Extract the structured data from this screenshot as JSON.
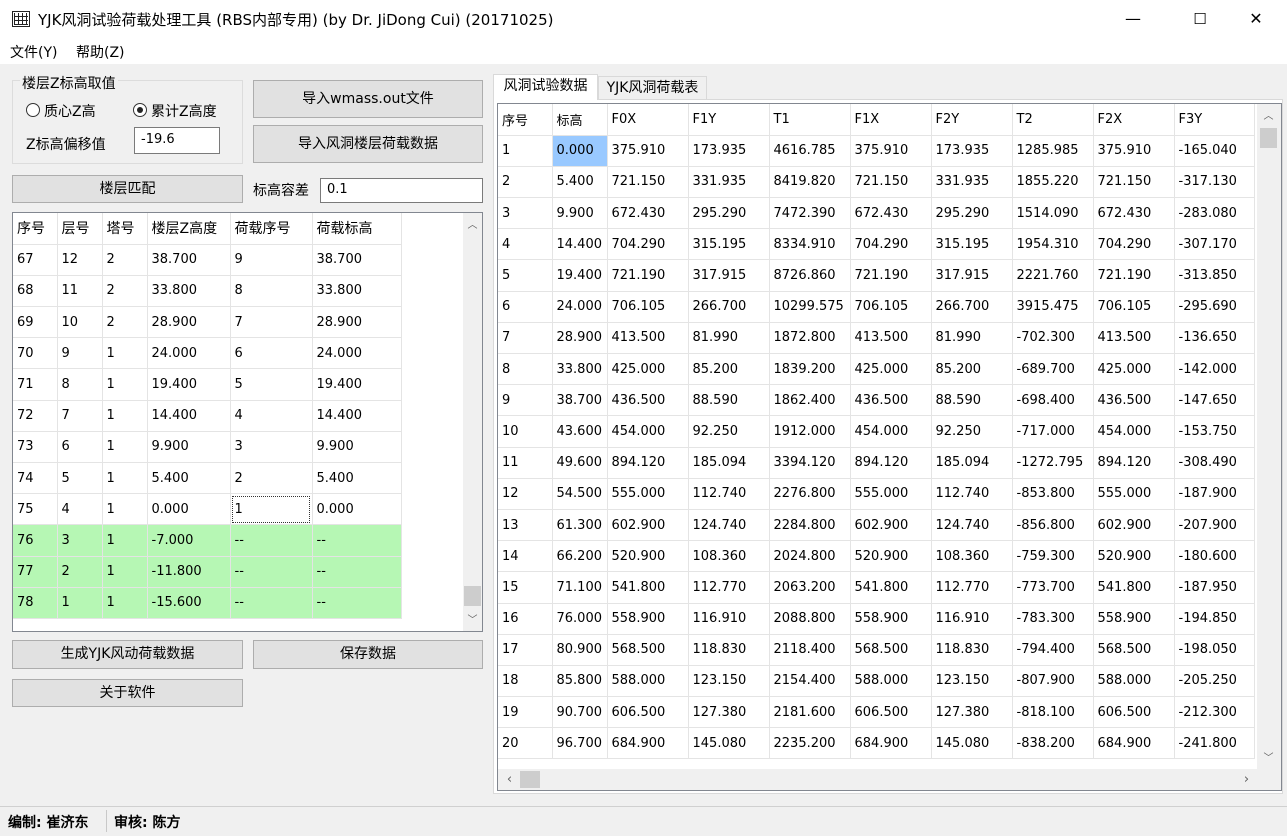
{
  "window": {
    "title": "YJK风洞试验荷载处理工具 (RBS内部专用) (by Dr. JiDong Cui) (20171025)",
    "minimize": "—",
    "maximize": "☐",
    "close": "✕"
  },
  "menu": {
    "file": "文件(Y)",
    "help": "帮助(Z)"
  },
  "zgroup": {
    "legend": "楼层Z标高取值",
    "radio_center": "质心Z高",
    "radio_cumulative": "累计Z高度",
    "selected": "radio_cumulative",
    "offset_label": "Z标高偏移值",
    "offset_value": "-19.6"
  },
  "buttons": {
    "import_wmass": "导入wmass.out文件",
    "import_windtunnel": "导入风洞楼层荷载数据",
    "floor_match": "楼层匹配",
    "generate": "生成YJK风动荷载数据",
    "save": "保存数据",
    "about": "关于软件"
  },
  "tolerance": {
    "label": "标高容差",
    "value": "0.1"
  },
  "left_grid": {
    "headers": [
      "序号",
      "层号",
      "塔号",
      "楼层Z高度",
      "荷载序号",
      "荷载标高"
    ],
    "rows": [
      [
        "67",
        "12",
        "2",
        "38.700",
        "9",
        "38.700"
      ],
      [
        "68",
        "11",
        "2",
        "33.800",
        "8",
        "33.800"
      ],
      [
        "69",
        "10",
        "2",
        "28.900",
        "7",
        "28.900"
      ],
      [
        "70",
        "9",
        "1",
        "24.000",
        "6",
        "24.000"
      ],
      [
        "71",
        "8",
        "1",
        "19.400",
        "5",
        "19.400"
      ],
      [
        "72",
        "7",
        "1",
        "14.400",
        "4",
        "14.400"
      ],
      [
        "73",
        "6",
        "1",
        "9.900",
        "3",
        "9.900"
      ],
      [
        "74",
        "5",
        "1",
        "5.400",
        "2",
        "5.400"
      ],
      [
        "75",
        "4",
        "1",
        "0.000",
        "1",
        "0.000"
      ],
      [
        "76",
        "3",
        "1",
        "-7.000",
        "--",
        "--"
      ],
      [
        "77",
        "2",
        "1",
        "-11.800",
        "--",
        "--"
      ],
      [
        "78",
        "1",
        "1",
        "-15.600",
        "--",
        "--"
      ]
    ],
    "highlight_rows": [
      9,
      10,
      11
    ],
    "highlight_color": "#b6f7b4"
  },
  "tabs": [
    "风洞试验数据",
    "YJK风洞荷载表"
  ],
  "right_grid": {
    "headers": [
      "序号",
      "标高",
      "F0X",
      "F1Y",
      "T1",
      "F1X",
      "F2Y",
      "T2",
      "F2X",
      "F3Y"
    ],
    "rows": [
      [
        "1",
        "0.000",
        "375.910",
        "173.935",
        "4616.785",
        "375.910",
        "173.935",
        "1285.985",
        "375.910",
        "-165.040"
      ],
      [
        "2",
        "5.400",
        "721.150",
        "331.935",
        "8419.820",
        "721.150",
        "331.935",
        "1855.220",
        "721.150",
        "-317.130"
      ],
      [
        "3",
        "9.900",
        "672.430",
        "295.290",
        "7472.390",
        "672.430",
        "295.290",
        "1514.090",
        "672.430",
        "-283.080"
      ],
      [
        "4",
        "14.400",
        "704.290",
        "315.195",
        "8334.910",
        "704.290",
        "315.195",
        "1954.310",
        "704.290",
        "-307.170"
      ],
      [
        "5",
        "19.400",
        "721.190",
        "317.915",
        "8726.860",
        "721.190",
        "317.915",
        "2221.760",
        "721.190",
        "-313.850"
      ],
      [
        "6",
        "24.000",
        "706.105",
        "266.700",
        "10299.575",
        "706.105",
        "266.700",
        "3915.475",
        "706.105",
        "-295.690"
      ],
      [
        "7",
        "28.900",
        "413.500",
        "81.990",
        "1872.800",
        "413.500",
        "81.990",
        "-702.300",
        "413.500",
        "-136.650"
      ],
      [
        "8",
        "33.800",
        "425.000",
        "85.200",
        "1839.200",
        "425.000",
        "85.200",
        "-689.700",
        "425.000",
        "-142.000"
      ],
      [
        "9",
        "38.700",
        "436.500",
        "88.590",
        "1862.400",
        "436.500",
        "88.590",
        "-698.400",
        "436.500",
        "-147.650"
      ],
      [
        "10",
        "43.600",
        "454.000",
        "92.250",
        "1912.000",
        "454.000",
        "92.250",
        "-717.000",
        "454.000",
        "-153.750"
      ],
      [
        "11",
        "49.600",
        "894.120",
        "185.094",
        "3394.120",
        "894.120",
        "185.094",
        "-1272.795",
        "894.120",
        "-308.490"
      ],
      [
        "12",
        "54.500",
        "555.000",
        "112.740",
        "2276.800",
        "555.000",
        "112.740",
        "-853.800",
        "555.000",
        "-187.900"
      ],
      [
        "13",
        "61.300",
        "602.900",
        "124.740",
        "2284.800",
        "602.900",
        "124.740",
        "-856.800",
        "602.900",
        "-207.900"
      ],
      [
        "14",
        "66.200",
        "520.900",
        "108.360",
        "2024.800",
        "520.900",
        "108.360",
        "-759.300",
        "520.900",
        "-180.600"
      ],
      [
        "15",
        "71.100",
        "541.800",
        "112.770",
        "2063.200",
        "541.800",
        "112.770",
        "-773.700",
        "541.800",
        "-187.950"
      ],
      [
        "16",
        "76.000",
        "558.900",
        "116.910",
        "2088.800",
        "558.900",
        "116.910",
        "-783.300",
        "558.900",
        "-194.850"
      ],
      [
        "17",
        "80.900",
        "568.500",
        "118.830",
        "2118.400",
        "568.500",
        "118.830",
        "-794.400",
        "568.500",
        "-198.050"
      ],
      [
        "18",
        "85.800",
        "588.000",
        "123.150",
        "2154.400",
        "588.000",
        "123.150",
        "-807.900",
        "588.000",
        "-205.250"
      ],
      [
        "19",
        "90.700",
        "606.500",
        "127.380",
        "2181.600",
        "606.500",
        "127.380",
        "-818.100",
        "606.500",
        "-212.300"
      ],
      [
        "20",
        "96.700",
        "684.900",
        "145.080",
        "2235.200",
        "684.900",
        "145.080",
        "-838.200",
        "684.900",
        "-241.800"
      ]
    ],
    "selected_cell_color": "#99c9ff"
  },
  "status": {
    "editor": "编制: 崔济东",
    "reviewer": "审核: 陈方"
  }
}
